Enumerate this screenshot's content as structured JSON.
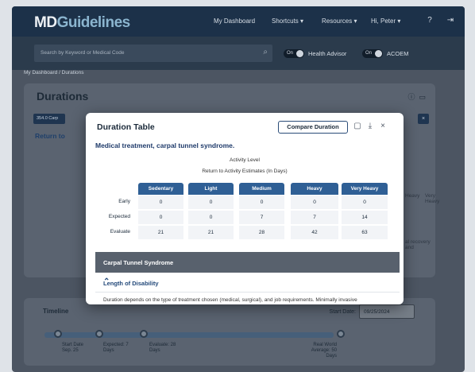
{
  "header": {
    "logo_md": "MD",
    "logo_guidelines": "Guidelines",
    "nav": [
      "My Dashboard",
      "Shortcuts ▾",
      "Resources ▾",
      "Hi, Peter ▾"
    ]
  },
  "search": {
    "placeholder": "Search by Keyword or Medical Code",
    "toggle_on": "On",
    "health_advisor": "Health Advisor",
    "acoem": "ACOEM"
  },
  "breadcrumb": "My Dashboard / Durations",
  "page": {
    "title": "Durations",
    "pill": "354.0 Carp",
    "return_to": "Return to",
    "right_heavy": "Heavy",
    "right_very_heavy": "Very Heavy",
    "right_recovery": "al recovery and"
  },
  "timeline": {
    "title": "Timeline",
    "start_date_label": "Start Date:",
    "start_date_value": "09/25/2024",
    "notes": {
      "start": "Start Date Sep. 25",
      "expected": "Expected: 7 Days",
      "evaluate": "Evaluate: 28 Days",
      "real_world": "Real World Average: 50 Days"
    }
  },
  "modal": {
    "title": "Duration Table",
    "compare_button": "Compare Duration",
    "subtitle": "Medical treatment, carpal tunnel syndrome.",
    "activity_level": "Activity Level",
    "estimates_label": "Return to Activity Estimates (In Days)",
    "columns": [
      "Sedentary",
      "Light",
      "Medium",
      "Heavy",
      "Very Heavy"
    ],
    "row_labels": [
      "Early",
      "Expected",
      "Evaluate"
    ],
    "rows": [
      [
        "0",
        "0",
        "0",
        "0",
        "0"
      ],
      [
        "0",
        "0",
        "7",
        "7",
        "14"
      ],
      [
        "21",
        "21",
        "28",
        "42",
        "63"
      ]
    ],
    "section_title": "Carpal Tunnel Syndrome",
    "accordion_label": "Length of Disability",
    "body_text": "Duration depends on the type of treatment chosen (medical, surgical), and job requirements. Minimally invasive"
  }
}
